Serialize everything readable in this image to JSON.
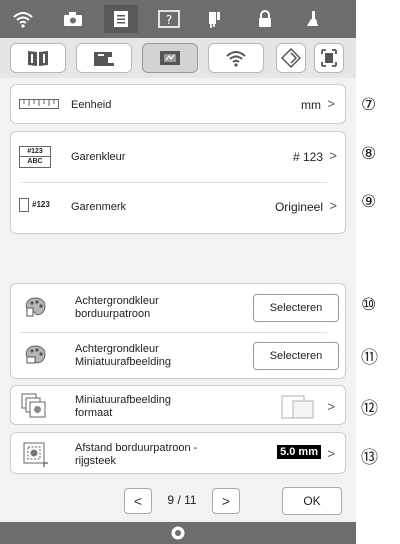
{
  "top_icons": [
    "wifi-icon",
    "camera-icon",
    "page-icon",
    "help-icon",
    "needle-icon",
    "lock-icon",
    "presser-foot-icon"
  ],
  "sub_tabs": [
    "book-icon",
    "sewing-machine-icon",
    "embroidery-icon",
    "wifi-icon",
    "settings-diamond-icon",
    "frame-icon"
  ],
  "rows": {
    "unit": {
      "label": "Eenheid",
      "value": "mm",
      "callout": "⑦",
      "icon_text": ""
    },
    "thread_color": {
      "label": "Garenkleur",
      "value": "# 123",
      "callout": "⑧",
      "icon_text_top": "#123",
      "icon_text_bottom": "ABC"
    },
    "thread_brand": {
      "label": "Garenmerk",
      "value": "Origineel",
      "callout": "⑨",
      "icon_text": "#123"
    },
    "bg_pattern": {
      "label_line1": "Achtergrondkleur",
      "label_line2": "borduurpatroon",
      "button": "Selecteren",
      "callout": "⑩"
    },
    "bg_thumb": {
      "label_line1": "Achtergrondkleur",
      "label_line2": "Miniatuurafbeelding",
      "button": "Selecteren",
      "callout": "⑪"
    },
    "thumb_size": {
      "label_line1": "Miniatuurafbeelding",
      "label_line2": "formaat",
      "callout": "⑫"
    },
    "distance": {
      "label_line1": "Afstand borduurpatroon -",
      "label_line2": "rijgsteek",
      "value": "5.0 mm",
      "callout": "⑬"
    }
  },
  "pager": {
    "current": "9",
    "separator": "/",
    "total": "11",
    "prev": "<",
    "next": ">"
  },
  "ok_label": "OK",
  "chevron": ">"
}
